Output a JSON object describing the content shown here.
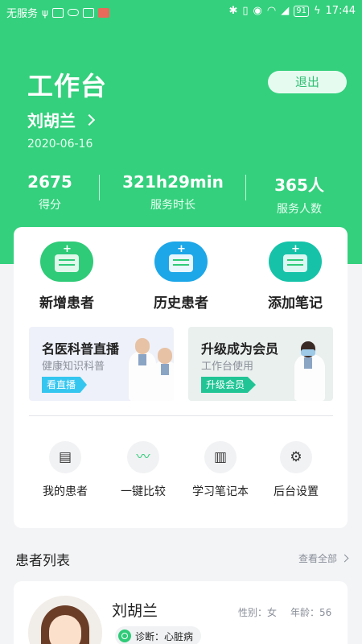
{
  "status_bar": {
    "carrier": "无服务",
    "battery": "91",
    "time": "17:44"
  },
  "header": {
    "title": "工作台",
    "logout_label": "退出",
    "user_name": "刘胡兰",
    "date": "2020-06-16"
  },
  "stats": [
    {
      "value": "2675",
      "label": "得分"
    },
    {
      "value": "321h29min",
      "label": "服务时长"
    },
    {
      "value": "365人",
      "label": "服务人数"
    }
  ],
  "actions": [
    {
      "label": "新增患者",
      "icon": "add-patient-icon",
      "color": "#2fcb78"
    },
    {
      "label": "历史患者",
      "icon": "patient-history-icon",
      "color": "#1da7e8"
    },
    {
      "label": "添加笔记",
      "icon": "add-note-icon",
      "color": "#16c3a9"
    }
  ],
  "banners": [
    {
      "title": "名医科普直播",
      "subtitle": "健康知识科普",
      "tag": "看直播"
    },
    {
      "title": "升级成为会员",
      "subtitle": "工作台使用",
      "tag": "升级会员"
    }
  ],
  "tools": [
    {
      "label": "我的患者",
      "icon": "clipboard-check-icon"
    },
    {
      "label": "一键比较",
      "icon": "chart-icon"
    },
    {
      "label": "学习笔记本",
      "icon": "notebook-icon"
    },
    {
      "label": "后台设置",
      "icon": "gear-icon"
    }
  ],
  "patient_list": {
    "title": "患者列表",
    "view_all": "查看全部",
    "patients": [
      {
        "name": "刘胡兰",
        "gender": "性别：女",
        "age": "年龄：56",
        "diagnosis": "诊断：心脏病"
      }
    ]
  },
  "colors": {
    "primary": "#34d07d",
    "background": "#f3f4f6"
  }
}
